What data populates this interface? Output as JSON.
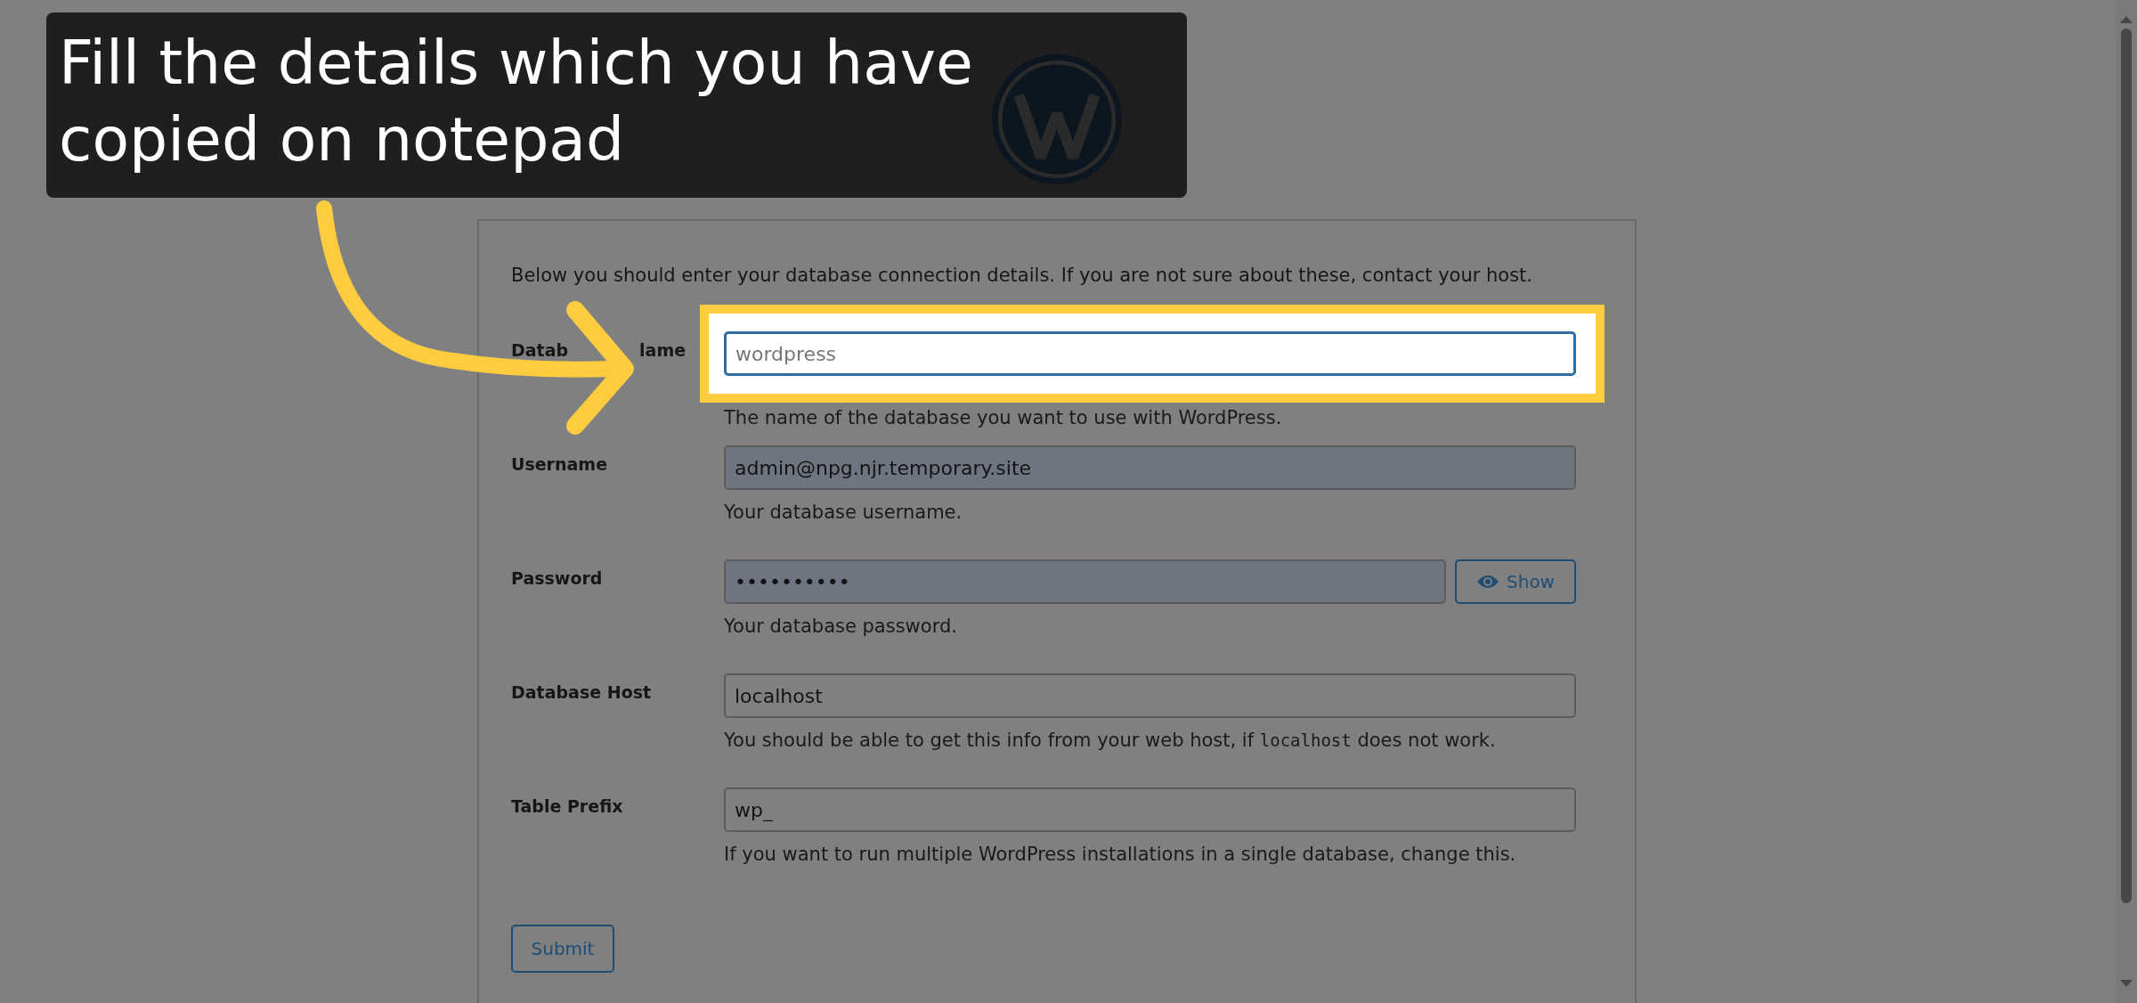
{
  "tutorial_callout": {
    "lines": [
      "Fill the details which you have",
      "copied on notepad"
    ]
  },
  "intro": "Below you should enter your database connection details. If you are not sure about these, contact your host.",
  "fields": [
    {
      "kind": "text",
      "label_parts": [
        "Datab",
        "lame"
      ],
      "placeholder": "wordpress",
      "focused": true,
      "highlighted": true,
      "autofilled": false,
      "hint_parts": [
        {
          "kind": "plain",
          "text": "The name of the database you want to use with WordPress."
        }
      ]
    },
    {
      "kind": "text",
      "label": "Username",
      "value": "admin@npg.njr.temporary.site",
      "focused": false,
      "highlighted": false,
      "autofilled": true,
      "hint_parts": [
        {
          "kind": "plain",
          "text": "Your database username."
        }
      ]
    },
    {
      "kind": "password",
      "label": "Password",
      "value": "••••••••••",
      "focused": false,
      "highlighted": false,
      "autofilled": true,
      "show_button": "Show",
      "hint_parts": [
        {
          "kind": "plain",
          "text": "Your database password."
        }
      ]
    },
    {
      "kind": "text",
      "label": "Database Host",
      "value": "localhost",
      "focused": false,
      "highlighted": false,
      "autofilled": false,
      "hint_parts": [
        {
          "kind": "plain",
          "text": "You should be able to get this info from your web host, if "
        },
        {
          "kind": "code",
          "text": "localhost"
        },
        {
          "kind": "plain",
          "text": " does not work."
        }
      ]
    },
    {
      "kind": "text",
      "label": "Table Prefix",
      "value": "wp_",
      "focused": false,
      "highlighted": false,
      "autofilled": false,
      "hint_parts": [
        {
          "kind": "plain",
          "text": "If you want to run multiple WordPress installations in a single database, change this."
        }
      ]
    }
  ],
  "submit_button": "Submit"
}
